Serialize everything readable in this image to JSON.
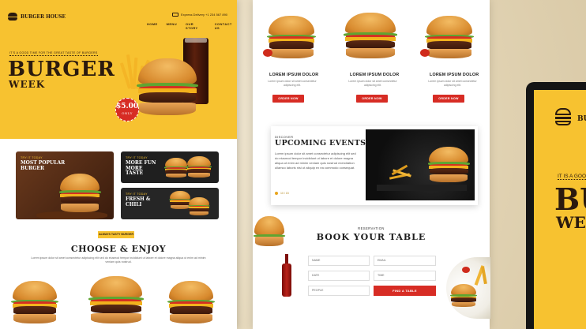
{
  "left": {
    "brand": "BURGER HOUSE",
    "delivery": "Express Delivery +1 234 567 890",
    "nav": [
      "HOME",
      "MENU",
      "OUR STORY",
      "CONTACT US"
    ],
    "hero": {
      "kicker": "IT'S A GOOD TIME FOR THE GREAT TASTE OF BURGERS",
      "title_1": "BURGER",
      "title_2": "WEEK",
      "price": "$5.00",
      "price_label": "ONLY"
    },
    "promos": [
      {
        "kicker": "TRY IT TODAY",
        "title": "MOST POPULAR BURGER"
      },
      {
        "kicker": "TRY IT TODAY",
        "title": "MORE FUN MORE TASTE"
      },
      {
        "kicker": "TRY IT TODAY",
        "title": "FRESH & CHILI"
      }
    ],
    "section_pill": "ALWAYS TASTY BURGER",
    "section_title": "CHOOSE & ENJOY",
    "section_text": "Lorem ipsum dolor sit amet consectetur adipiscing elit sed do eiusmod tempor incididunt ut labore et dolore magna aliqua ut enim ad minim veniam quis nostrud."
  },
  "middle": {
    "products": [
      {
        "name": "LOREM IPSUM DOLOR",
        "desc": "Lorem ipsum dolor sit amet consectetur adipiscing elit.",
        "button": "ORDER NOW"
      },
      {
        "name": "LOREM IPSUM DOLOR",
        "desc": "Lorem ipsum dolor sit amet consectetur adipiscing elit.",
        "button": "ORDER NOW"
      },
      {
        "name": "LOREM IPSUM DOLOR",
        "desc": "Lorem ipsum dolor sit amet consectetur adipiscing elit.",
        "button": "ORDER NOW"
      }
    ],
    "events": {
      "kicker": "DISCOVER",
      "title": "UPCOMING EVENTS",
      "text": "Lorem ipsum dolor sit amet consectetur adipiscing elit sed do eiusmod tempor incididunt ut labore et dolore magna aliqua ut enim ad minim veniam quis nostrud exercitation ullamco laboris nisi ut aliquip ex ea commodo consequat.",
      "link": "10 / 15"
    },
    "booking": {
      "kicker": "RESERVATION",
      "title": "BOOK YOUR TABLE",
      "fields": [
        "NAME",
        "EMAIL",
        "DATE",
        "TIME",
        "PEOPLE"
      ],
      "submit": "FIND A TABLE"
    }
  },
  "device": {
    "logo": "BURG",
    "kicker": "IT IS A GOOD TIME",
    "title_1": "BU",
    "title_2": "WE"
  },
  "colors": {
    "accent": "#f7c230",
    "red": "#d72c24",
    "dark": "#2b1a0e"
  }
}
